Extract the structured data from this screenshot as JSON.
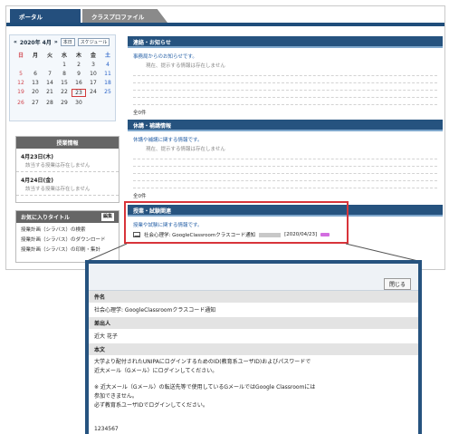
{
  "tabs": {
    "portal": "ポータル",
    "class_profile": "クラスプロファイル"
  },
  "calendar": {
    "title": "2020年 4月",
    "prev_label": "«",
    "next_label": "»",
    "today_button": "本日",
    "schedule_button": "スケジュール",
    "weekdays": [
      "日",
      "月",
      "火",
      "水",
      "木",
      "金",
      "土"
    ],
    "weeks": [
      [
        "",
        "",
        "",
        "1",
        "2",
        "3",
        "4"
      ],
      [
        "5",
        "6",
        "7",
        "8",
        "9",
        "10",
        "11"
      ],
      [
        "12",
        "13",
        "14",
        "15",
        "16",
        "17",
        "18"
      ],
      [
        "19",
        "20",
        "21",
        "22",
        "23",
        "24",
        "25"
      ],
      [
        "26",
        "27",
        "28",
        "29",
        "30",
        "",
        ""
      ]
    ],
    "selected_day": "23"
  },
  "lesson_info": {
    "title": "授業情報",
    "entries": [
      {
        "date": "4月23日(木)",
        "note": "該当する授業は存在しません"
      },
      {
        "date": "4月24日(金)",
        "note": "該当する授業は存在しません"
      }
    ]
  },
  "favorites": {
    "title": "お気に入りタイトル",
    "edit_button": "編集",
    "items": [
      "授業計画（シラバス）の検索",
      "授業計画（シラバス）のダウンロード",
      "授業計画（シラバス）の印刷・集計"
    ]
  },
  "panels": {
    "notice": {
      "title": "連絡・お知らせ",
      "sub": "事務局からのお知らせです。",
      "none": "現在、提示する情報は存在しません",
      "count": "全0件"
    },
    "cancel": {
      "title": "休講・補講情報",
      "sub": "休講や補講に関する情報です。",
      "none": "現在、提示する情報は存在しません",
      "count": "全0件"
    },
    "class_notice": {
      "title": "授業・試験関連",
      "sub": "授業や試験に関する情報です。",
      "item_text": "社会心理学: GoogleClassroomクラスコード通知",
      "item_date": "[2020/04/23]"
    }
  },
  "popup": {
    "close_button": "閉じる",
    "subject_label": "件名",
    "subject_value": "社会心理学: GoogleClassroomクラスコード通知",
    "sender_label": "差出人",
    "sender_value": "近大 花子",
    "body_label": "本文",
    "body_lines": [
      "大学より配付されたUNIPAにログインするためのID(教育系ユーザID)およびパスワードで",
      "近大メール（Gメール）にログインしてください。",
      "",
      "※ 近大メール（Gメール）の転送先等で使用しているGメールではGoogle Classroomには",
      "参加できません。",
      "必ず教育系ユーザIDでログインしてください。"
    ],
    "code": "1234567"
  },
  "colors": {
    "navy": "#26537f",
    "highlight": "#d8343a",
    "sunday": "#d2474f",
    "saturday": "#2a63c8"
  }
}
